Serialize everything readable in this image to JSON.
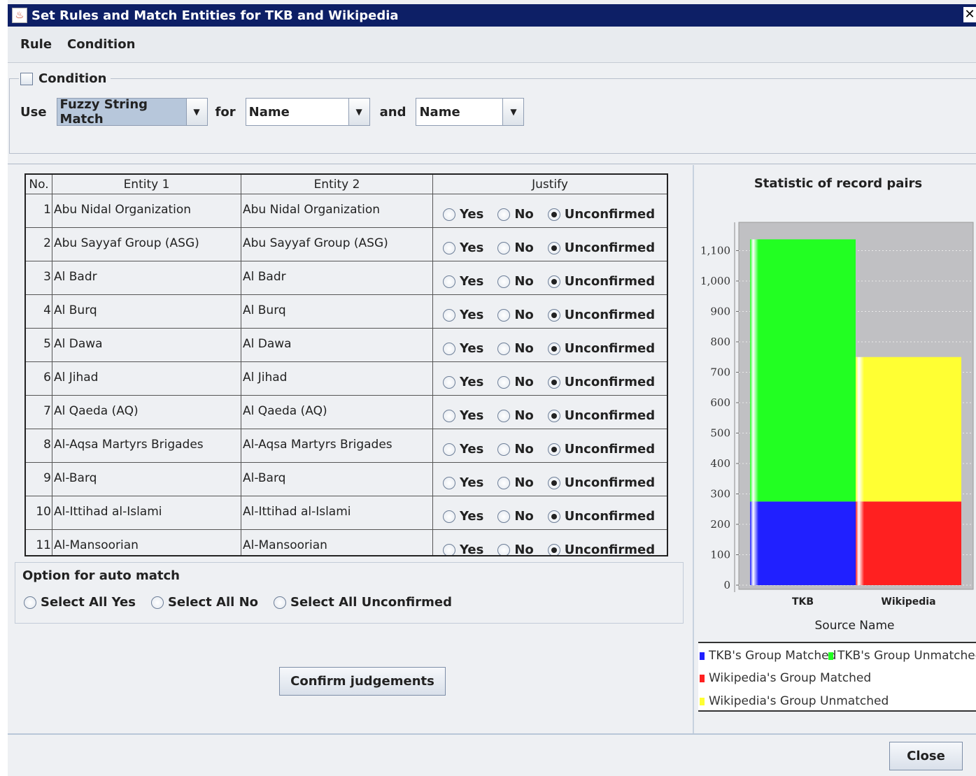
{
  "window": {
    "title": "Set Rules and Match Entities for TKB and Wikipedia",
    "close_glyph": "✕"
  },
  "menu": {
    "items": [
      "Rule",
      "Condition"
    ]
  },
  "condition": {
    "legend": "Condition",
    "checked": false,
    "use_label": "Use",
    "method": "Fuzzy String Match",
    "for_label": "for",
    "field1": "Name",
    "and_label": "and",
    "field2": "Name"
  },
  "table": {
    "columns": [
      "No.",
      "Entity 1",
      "Entity 2",
      "Justify"
    ],
    "radio_labels": [
      "Yes",
      "No",
      "Unconfirmed"
    ],
    "rows": [
      {
        "no": "1",
        "e1": "Abu Nidal Organization",
        "e2": "Abu Nidal Organization",
        "justify": "Unconfirmed"
      },
      {
        "no": "2",
        "e1": "Abu Sayyaf Group (ASG)",
        "e2": "Abu Sayyaf Group (ASG)",
        "justify": "Unconfirmed"
      },
      {
        "no": "3",
        "e1": "Al Badr",
        "e2": "Al Badr",
        "justify": "Unconfirmed"
      },
      {
        "no": "4",
        "e1": "Al Burq",
        "e2": "Al Burq",
        "justify": "Unconfirmed"
      },
      {
        "no": "5",
        "e1": "Al Dawa",
        "e2": "Al Dawa",
        "justify": "Unconfirmed"
      },
      {
        "no": "6",
        "e1": "Al Jihad",
        "e2": "Al Jihad",
        "justify": "Unconfirmed"
      },
      {
        "no": "7",
        "e1": "Al Qaeda (AQ)",
        "e2": "Al Qaeda (AQ)",
        "justify": "Unconfirmed"
      },
      {
        "no": "8",
        "e1": "Al-Aqsa Martyrs Brigades",
        "e2": "Al-Aqsa Martyrs Brigades",
        "justify": "Unconfirmed"
      },
      {
        "no": "9",
        "e1": "Al-Barq",
        "e2": "Al-Barq",
        "justify": "Unconfirmed"
      },
      {
        "no": "10",
        "e1": "Al-Ittihad al-Islami",
        "e2": "Al-Ittihad al-Islami",
        "justify": "Unconfirmed"
      },
      {
        "no": "11",
        "e1": "Al-Mansoorian",
        "e2": "Al-Mansoorian",
        "justify": "Unconfirmed"
      }
    ]
  },
  "auto_match": {
    "title": "Option for auto match",
    "options": [
      "Select All Yes",
      "Select All No",
      "Select All Unconfirmed"
    ]
  },
  "confirm_button": "Confirm judgements",
  "close_button": "Close",
  "chart_data": {
    "type": "bar",
    "stacked": true,
    "title": "Statistic of record pairs",
    "xlabel": "Source Name",
    "ylabel": "",
    "categories": [
      "TKB",
      "Wikipedia"
    ],
    "ylim": [
      0,
      1200
    ],
    "yticks": [
      0,
      100,
      200,
      300,
      400,
      500,
      600,
      700,
      800,
      900,
      1000,
      1100
    ],
    "ytick_labels": [
      "0",
      "100",
      "200",
      "300",
      "400",
      "500",
      "600",
      "700",
      "800",
      "900",
      "1,000",
      "1,100"
    ],
    "grid": true,
    "legend_position": "bottom",
    "series": [
      {
        "name": "TKB's Group Matched",
        "color": "#2020ff",
        "values": [
          275,
          0
        ]
      },
      {
        "name": "TKB's Group Unmatched",
        "color": "#22ff22",
        "values": [
          862,
          0
        ]
      },
      {
        "name": "Wikipedia's Group Matched",
        "color": "#ff2020",
        "values": [
          0,
          275
        ]
      },
      {
        "name": "Wikipedia's Group Unmatched",
        "color": "#ffff33",
        "values": [
          0,
          475
        ]
      }
    ]
  }
}
